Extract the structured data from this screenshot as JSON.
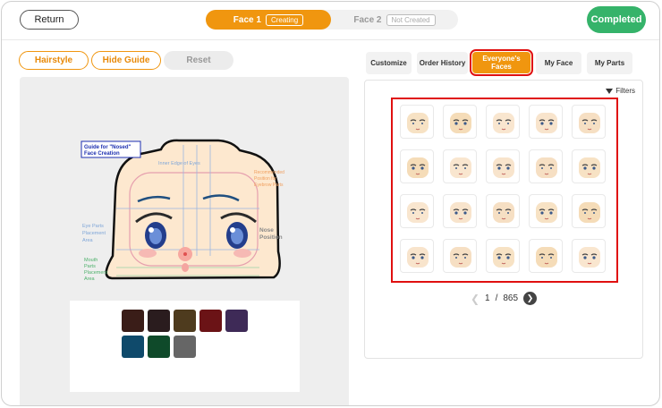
{
  "header": {
    "return_label": "Return",
    "face_tabs": [
      {
        "label": "Face 1",
        "status": "Creating"
      },
      {
        "label": "Face 2",
        "status": "Not Created"
      }
    ],
    "completed_label": "Completed"
  },
  "tools": {
    "hairstyle": "Hairstyle",
    "hide_guide": "Hide Guide",
    "reset": "Reset"
  },
  "guide": {
    "title_line1": "Guide for \"Nosed\"",
    "title_line2": "Face Creation",
    "inner_edge": "Inner Edge of Eyes",
    "eyebrow_1": "Recommended",
    "eyebrow_2": "Position for",
    "eyebrow_3": "Eyebrow Parts",
    "eye_1": "Eye Parts",
    "eye_2": "Placement",
    "eye_3": "Area",
    "mouth_1": "Mouth",
    "mouth_2": "Parts",
    "mouth_3": "Placement",
    "mouth_4": "Area",
    "nose_1": "Nose",
    "nose_2": "Position"
  },
  "swatches": [
    "#3a1d18",
    "#2a1c1e",
    "#4e3b1e",
    "#6b1316",
    "#3e2a57",
    "#0f4a6b",
    "#0f4a2a",
    "#666666"
  ],
  "right_tabs": {
    "customize": "Customize",
    "order_history": "Order History",
    "everyones_faces_1": "Everyone's",
    "everyones_faces_2": "Faces",
    "my_face": "My Face",
    "my_parts": "My Parts"
  },
  "filters_label": "Filters",
  "pagination": {
    "current": "1",
    "separator": "/",
    "total": "865"
  }
}
